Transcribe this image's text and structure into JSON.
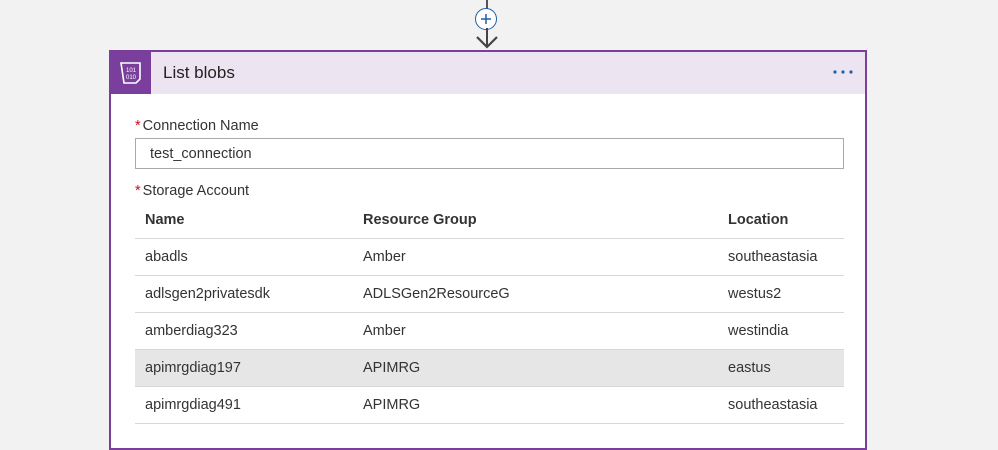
{
  "card": {
    "title": "List blobs"
  },
  "form": {
    "connection_label": "Connection Name",
    "connection_value": "test_connection",
    "storage_label": "Storage Account",
    "required_marker": "*"
  },
  "table": {
    "headers": [
      "Name",
      "Resource Group",
      "Location"
    ],
    "rows": [
      {
        "name": "abadls",
        "resource_group": "Amber",
        "location": "southeastasia"
      },
      {
        "name": "adlsgen2privatesdk",
        "resource_group": "ADLSGen2ResourceG",
        "location": "westus2"
      },
      {
        "name": "amberdiag323",
        "resource_group": "Amber",
        "location": "westindia"
      },
      {
        "name": "apimrgdiag197",
        "resource_group": "APIMRG",
        "location": "eastus"
      },
      {
        "name": "apimrgdiag491",
        "resource_group": "APIMRG",
        "location": "southeastasia"
      }
    ],
    "selected_row": 3
  },
  "icons": {
    "add_step": "plus-circle-icon",
    "arrow": "arrow-down-icon",
    "header": "blob-storage-icon",
    "more": "ellipsis-icon"
  },
  "colors": {
    "accent": "#7a3f9d",
    "header_bg": "#ece5f1",
    "link_blue": "#1f5ea8",
    "selected_row": "#e6e6e6"
  }
}
